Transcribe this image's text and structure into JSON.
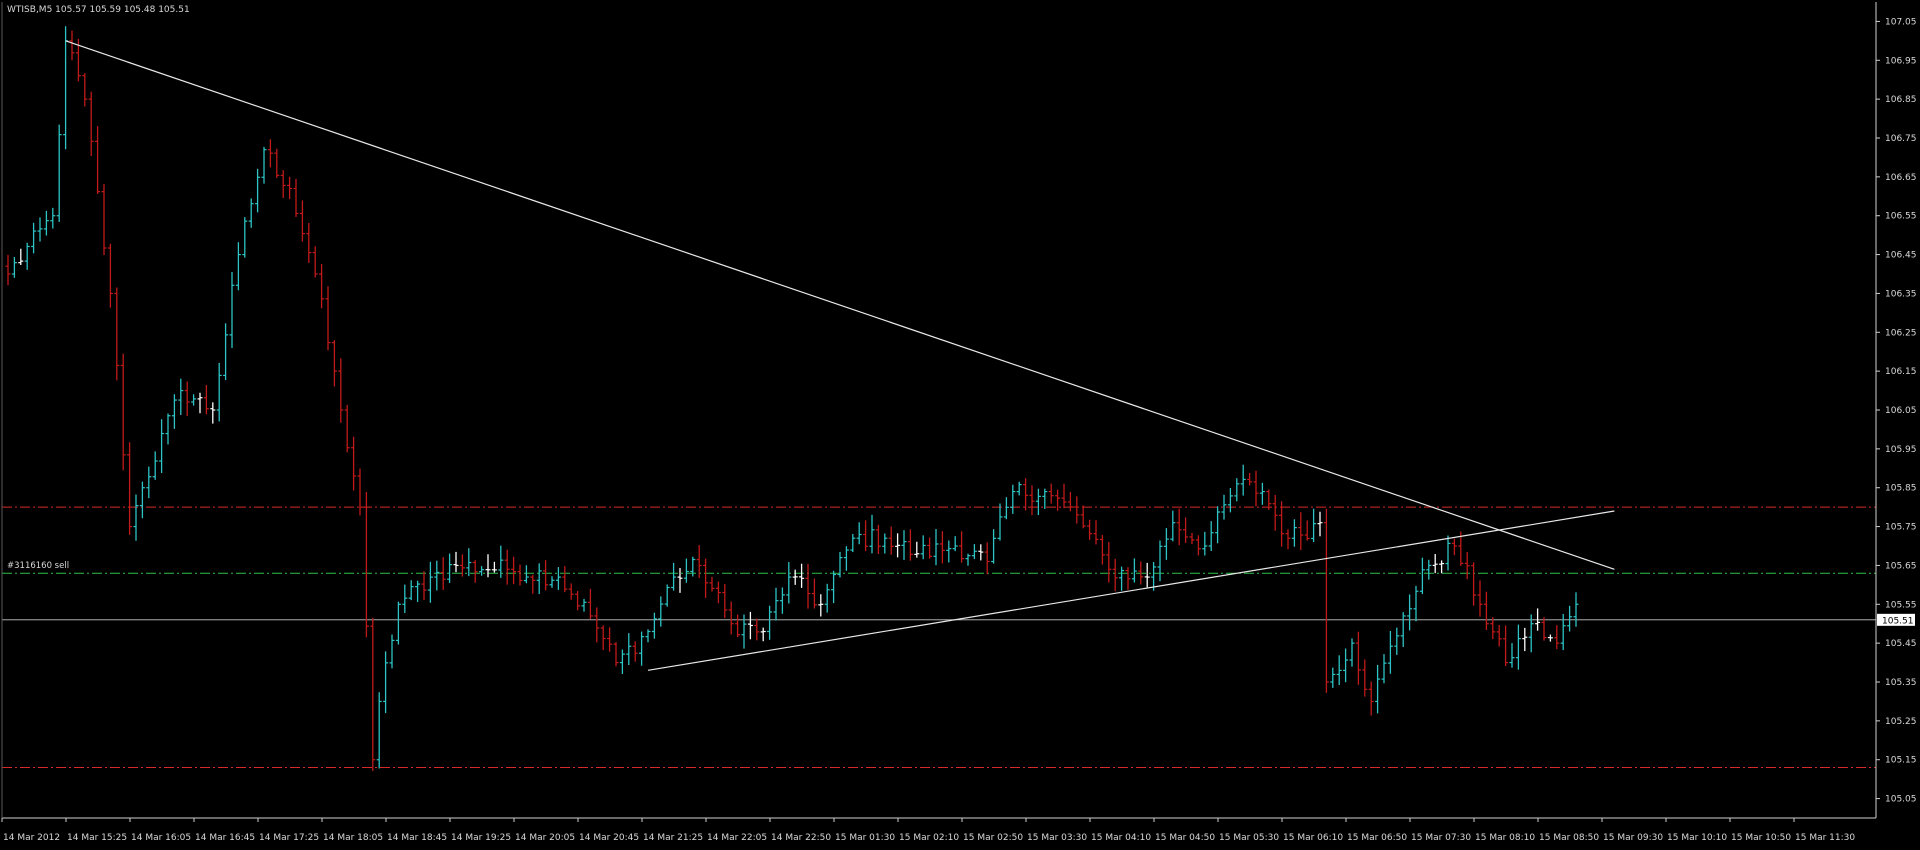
{
  "header": {
    "symbol_info": "WTISB,M5  105.57 105.59 105.48 105.51"
  },
  "trade_label": "#3116160 sell",
  "current_price_label": "105.51",
  "colors": {
    "background": "#000000",
    "grid": "#ffffff",
    "bull": "#2ec4c6",
    "bear": "#c21a1a",
    "doji": "#ffffff",
    "trendline": "#e8e8e8",
    "level_red": "#d42a2a",
    "level_green": "#2fbf4a",
    "bid_line": "#c8c8c8",
    "text": "#d8d8d8"
  },
  "chart_data": {
    "type": "ohlc",
    "title": "",
    "xlabel": "",
    "ylabel": "",
    "ylim": [
      105.0,
      107.1
    ],
    "y_ticks": [
      "107.05",
      "106.95",
      "106.85",
      "106.75",
      "106.65",
      "106.55",
      "106.45",
      "106.35",
      "106.25",
      "106.15",
      "106.05",
      "105.95",
      "105.85",
      "105.75",
      "105.65",
      "105.55",
      "105.45",
      "105.35",
      "105.25",
      "105.15",
      "105.05"
    ],
    "x_labels": [
      "14 Mar 2012",
      "14 Mar 15:25",
      "14 Mar 16:05",
      "14 Mar 16:45",
      "14 Mar 17:25",
      "14 Mar 18:05",
      "14 Mar 18:45",
      "14 Mar 19:25",
      "14 Mar 20:05",
      "14 Mar 20:45",
      "14 Mar 21:25",
      "14 Mar 22:05",
      "14 Mar 22:50",
      "15 Mar 01:30",
      "15 Mar 02:10",
      "15 Mar 02:50",
      "15 Mar 03:30",
      "15 Mar 04:10",
      "15 Mar 04:50",
      "15 Mar 05:30",
      "15 Mar 06:10",
      "15 Mar 06:50",
      "15 Mar 07:30",
      "15 Mar 08:10",
      "15 Mar 08:50",
      "15 Mar 09:30",
      "15 Mar 10:10",
      "15 Mar 10:50",
      "15 Mar 11:30"
    ],
    "x_label_interval_bars": 8,
    "key_points": [
      {
        "bar": 0,
        "price": 106.4
      },
      {
        "bar": 7,
        "price": 106.55
      },
      {
        "bar": 9,
        "price": 107.0
      },
      {
        "bar": 12,
        "price": 106.85
      },
      {
        "bar": 16,
        "price": 106.35
      },
      {
        "bar": 19,
        "price": 105.75
      },
      {
        "bar": 21,
        "price": 105.85
      },
      {
        "bar": 27,
        "price": 106.1
      },
      {
        "bar": 32,
        "price": 106.05
      },
      {
        "bar": 36,
        "price": 106.45
      },
      {
        "bar": 40,
        "price": 106.72
      },
      {
        "bar": 44,
        "price": 106.62
      },
      {
        "bar": 48,
        "price": 106.4
      },
      {
        "bar": 52,
        "price": 106.05
      },
      {
        "bar": 55,
        "price": 105.8
      },
      {
        "bar": 57,
        "price": 105.15
      },
      {
        "bar": 58,
        "price": 105.3
      },
      {
        "bar": 61,
        "price": 105.55
      },
      {
        "bar": 66,
        "price": 105.62
      },
      {
        "bar": 70,
        "price": 105.65
      },
      {
        "bar": 78,
        "price": 105.64
      },
      {
        "bar": 86,
        "price": 105.62
      },
      {
        "bar": 91,
        "price": 105.52
      },
      {
        "bar": 95,
        "price": 105.4
      },
      {
        "bar": 100,
        "price": 105.48
      },
      {
        "bar": 104,
        "price": 105.62
      },
      {
        "bar": 108,
        "price": 105.65
      },
      {
        "bar": 113,
        "price": 105.5
      },
      {
        "bar": 118,
        "price": 105.48
      },
      {
        "bar": 122,
        "price": 105.62
      },
      {
        "bar": 127,
        "price": 105.55
      },
      {
        "bar": 132,
        "price": 105.72
      },
      {
        "bar": 137,
        "price": 105.72
      },
      {
        "bar": 142,
        "price": 105.68
      },
      {
        "bar": 148,
        "price": 105.7
      },
      {
        "bar": 153,
        "price": 105.66
      },
      {
        "bar": 157,
        "price": 105.84
      },
      {
        "bar": 162,
        "price": 105.84
      },
      {
        "bar": 167,
        "price": 105.78
      },
      {
        "bar": 172,
        "price": 105.64
      },
      {
        "bar": 178,
        "price": 105.62
      },
      {
        "bar": 182,
        "price": 105.76
      },
      {
        "bar": 187,
        "price": 105.7
      },
      {
        "bar": 192,
        "price": 105.86
      },
      {
        "bar": 196,
        "price": 105.84
      },
      {
        "bar": 200,
        "price": 105.72
      },
      {
        "bar": 205,
        "price": 105.76
      },
      {
        "bar": 206,
        "price": 105.35
      },
      {
        "bar": 210,
        "price": 105.45
      },
      {
        "bar": 213,
        "price": 105.3
      },
      {
        "bar": 218,
        "price": 105.52
      },
      {
        "bar": 222,
        "price": 105.65
      },
      {
        "bar": 226,
        "price": 105.7
      },
      {
        "bar": 230,
        "price": 105.55
      },
      {
        "bar": 234,
        "price": 105.4
      },
      {
        "bar": 238,
        "price": 105.5
      },
      {
        "bar": 242,
        "price": 105.45
      },
      {
        "bar": 245,
        "price": 105.55
      }
    ],
    "bar_count": 246,
    "trendlines": [
      {
        "from": {
          "bar": 9,
          "price": 107.0
        },
        "to": {
          "bar": 251,
          "price": 105.64
        }
      },
      {
        "from": {
          "bar": 100,
          "price": 105.38
        },
        "to": {
          "bar": 251,
          "price": 105.79
        }
      }
    ],
    "levels": [
      {
        "price": 105.8,
        "style": "red-dashdot"
      },
      {
        "price": 105.63,
        "style": "green-dashdot",
        "label": "#3116160 sell"
      },
      {
        "price": 105.51,
        "style": "solid",
        "label": "105.51"
      },
      {
        "price": 105.13,
        "style": "red-dashdot"
      }
    ]
  }
}
